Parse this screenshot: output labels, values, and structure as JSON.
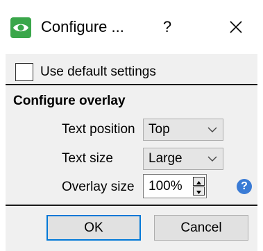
{
  "window": {
    "title": "Configure ...",
    "help_glyph": "?",
    "icon": "eye-app-icon",
    "accent_color": "#3aa64a"
  },
  "use_default": {
    "label": "Use default settings",
    "checked": false
  },
  "overlay": {
    "section_title": "Configure overlay",
    "text_position": {
      "label": "Text position",
      "value": "Top"
    },
    "text_size": {
      "label": "Text size",
      "value": "Large"
    },
    "overlay_size": {
      "label": "Overlay size",
      "value": "100%"
    },
    "info_glyph": "?"
  },
  "buttons": {
    "ok_label": "OK",
    "cancel_label": "Cancel"
  }
}
